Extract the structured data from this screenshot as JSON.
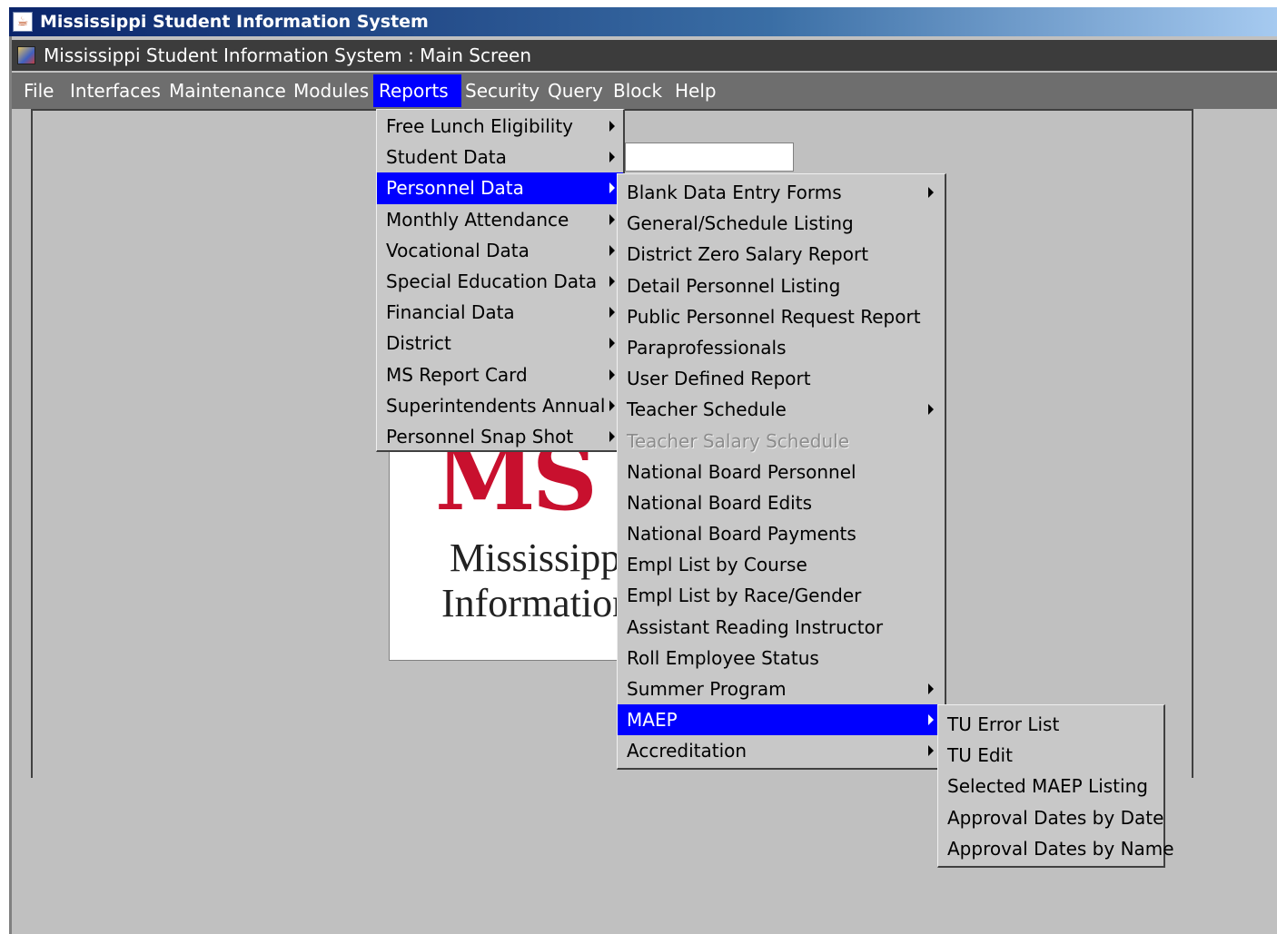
{
  "window": {
    "title": "Mississippi Student Information System"
  },
  "inner_window": {
    "title": "Mississippi Student Information System : Main Screen"
  },
  "menubar": {
    "items": [
      {
        "label": "File"
      },
      {
        "label": "Interfaces"
      },
      {
        "label": "Maintenance"
      },
      {
        "label": "Modules"
      },
      {
        "label": "Reports"
      },
      {
        "label": "Security"
      },
      {
        "label": "Query"
      },
      {
        "label": "Block"
      },
      {
        "label": "Help"
      }
    ],
    "active": "Reports"
  },
  "reports_menu": {
    "items": [
      {
        "label": "Free Lunch Eligibility",
        "submenu": true
      },
      {
        "label": "Student Data",
        "submenu": true
      },
      {
        "label": "Personnel Data",
        "submenu": true,
        "selected": true
      },
      {
        "label": "Monthly Attendance",
        "submenu": true
      },
      {
        "label": "Vocational Data",
        "submenu": true
      },
      {
        "label": "Special Education Data",
        "submenu": true
      },
      {
        "label": "Financial Data",
        "submenu": true
      },
      {
        "label": "District",
        "submenu": true
      },
      {
        "label": "MS Report Card",
        "submenu": true
      },
      {
        "label": "Superintendents Annual",
        "submenu": true
      },
      {
        "label": "Personnel Snap Shot",
        "submenu": true
      }
    ]
  },
  "personnel_menu": {
    "items": [
      {
        "label": "Blank Data Entry Forms",
        "submenu": true
      },
      {
        "label": "General/Schedule Listing"
      },
      {
        "label": "District Zero Salary Report"
      },
      {
        "label": "Detail Personnel Listing"
      },
      {
        "label": "Public Personnel Request Report"
      },
      {
        "label": "Paraprofessionals"
      },
      {
        "label": "User Defined Report"
      },
      {
        "label": "Teacher Schedule",
        "submenu": true
      },
      {
        "label": "Teacher Salary Schedule",
        "disabled": true
      },
      {
        "label": "National Board Personnel"
      },
      {
        "label": "National Board Edits"
      },
      {
        "label": "National Board Payments"
      },
      {
        "label": "Empl List by Course"
      },
      {
        "label": "Empl List by Race/Gender"
      },
      {
        "label": "Assistant Reading Instructor"
      },
      {
        "label": "Roll Employee Status"
      },
      {
        "label": "Summer Program",
        "submenu": true
      },
      {
        "label": "MAEP",
        "submenu": true,
        "selected": true
      },
      {
        "label": "Accreditation",
        "submenu": true
      }
    ]
  },
  "maep_menu": {
    "items": [
      {
        "label": "TU Error List"
      },
      {
        "label": "TU Edit"
      },
      {
        "label": "Selected MAEP Listing"
      },
      {
        "label": "Approval Dates by Date"
      },
      {
        "label": "Approval Dates by Name"
      }
    ]
  },
  "logo": {
    "mark": "MS",
    "line1": "Mississippi",
    "line2": "Information"
  },
  "colors": {
    "menu_selected": "#0000ff",
    "menubar": "#6e6e6e",
    "logo_red": "#c8102e"
  }
}
